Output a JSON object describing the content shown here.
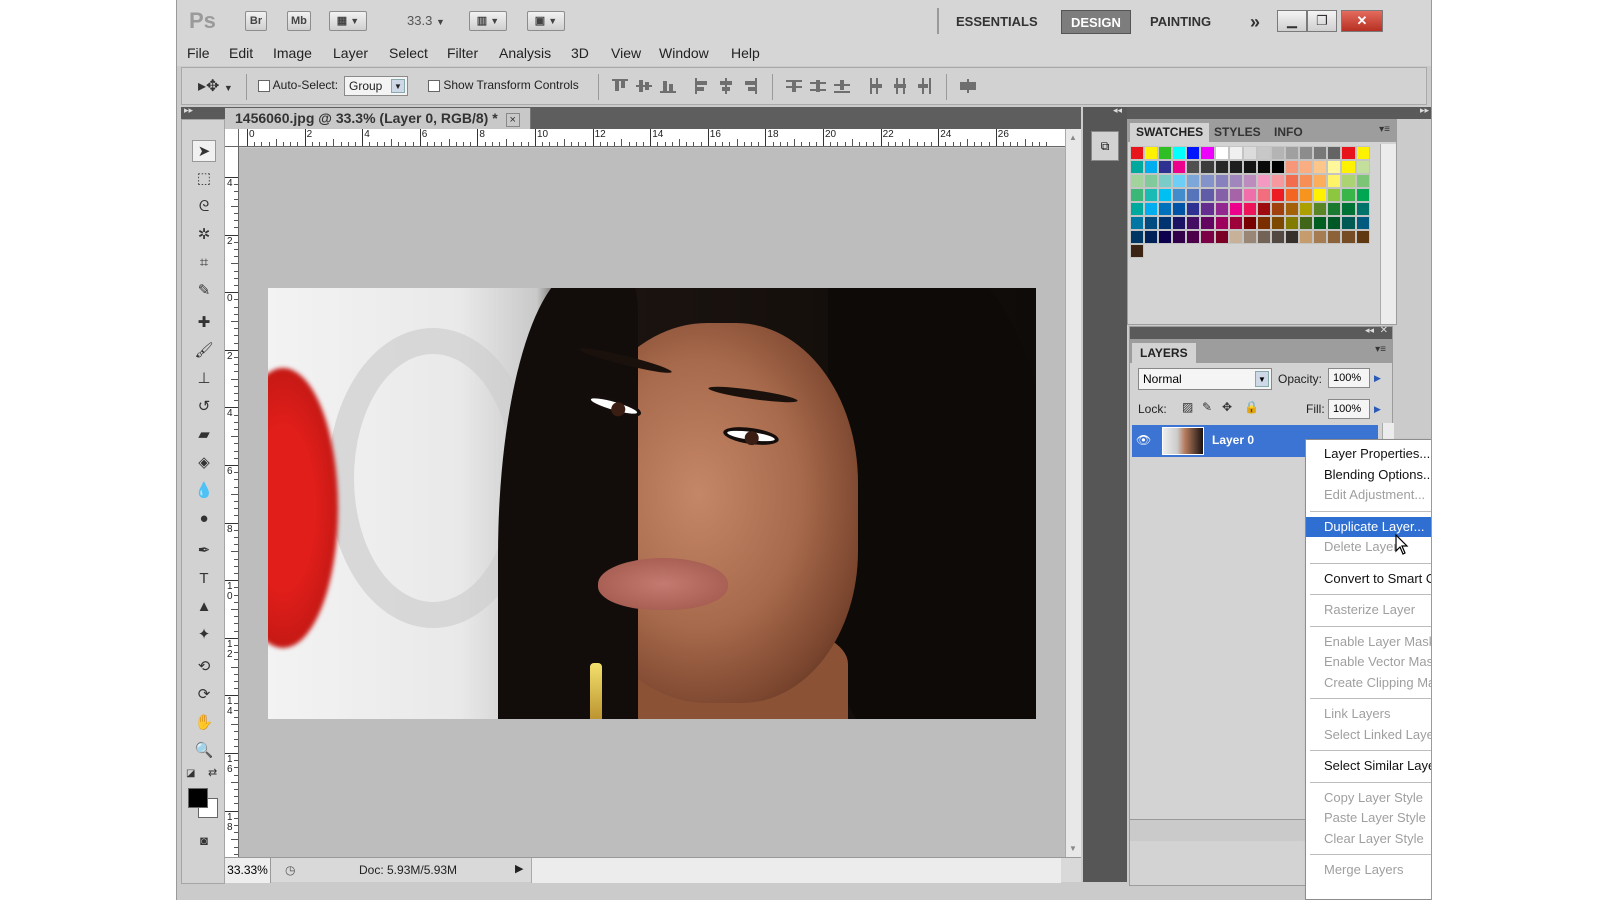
{
  "app": {
    "logo": "Ps",
    "bridge": "Br",
    "minibridge": "Mb",
    "zoom": "33.3",
    "workspaces": [
      "ESSENTIALS",
      "DESIGN",
      "PAINTING"
    ],
    "active_workspace": "DESIGN",
    "more": "»"
  },
  "menu": [
    "File",
    "Edit",
    "Image",
    "Layer",
    "Select",
    "Filter",
    "Analysis",
    "3D",
    "View",
    "Window",
    "Help"
  ],
  "options": {
    "auto_select_label": "Auto-Select:",
    "auto_select_value": "Group",
    "transform_label": "Show Transform Controls"
  },
  "document": {
    "tab_title": "1456060.jpg @ 33.3% (Layer 0, RGB/8) *",
    "close": "×",
    "ruler_h": [
      "0",
      "2",
      "4",
      "6",
      "8",
      "10",
      "12",
      "14",
      "16",
      "18",
      "20",
      "22",
      "24",
      "26"
    ],
    "ruler_v": [
      "4",
      "2",
      "0",
      "2",
      "4",
      "6",
      "8",
      "1 0",
      "1 2",
      "1 4",
      "1 6",
      "1 8"
    ],
    "zoom_status": "33.33%",
    "doc_status": "Doc: 5.93M/5.93M"
  },
  "swatches": {
    "tabs": [
      "SWATCHES",
      "STYLES",
      "INFO"
    ],
    "colors": [
      "#e8141c",
      "#fef200",
      "#2fbf25",
      "#00ffff",
      "#0015ff",
      "#ee00ff",
      "#ffffff",
      "#f0f0f0",
      "#dcdcdc",
      "#c8c8c8",
      "#b4b4b4",
      "#a0a0a0",
      "#8c8c8c",
      "#787878",
      "#646464",
      "#e8141c",
      "#fef200",
      "#00a99d",
      "#00aeef",
      "#2e3192",
      "#ec008c",
      "#505050",
      "#3c3c3c",
      "#282828",
      "#1e1e1e",
      "#141414",
      "#0a0a0a",
      "#000000",
      "#f7977a",
      "#f9ad81",
      "#fdc68a",
      "#fff79a",
      "#fff200",
      "#c4df9b",
      "#a3d39c",
      "#82ca9c",
      "#7accc8",
      "#6dcff6",
      "#7da7d9",
      "#8393ca",
      "#8781bd",
      "#a186be",
      "#bd8cbf",
      "#f49ac2",
      "#f6989d",
      "#f26c4f",
      "#f68e55",
      "#fbaf5d",
      "#fff467",
      "#acd372",
      "#7cc576",
      "#3bb878",
      "#1abbb4",
      "#00bff3",
      "#438ccb",
      "#5574b9",
      "#605ca8",
      "#855fa8",
      "#a763a8",
      "#f06ea9",
      "#f26d7d",
      "#ed1c24",
      "#f26522",
      "#f7941d",
      "#fff200",
      "#8dc63f",
      "#39b54a",
      "#00a651",
      "#00a99d",
      "#00aeef",
      "#0072bc",
      "#0054a6",
      "#2e3192",
      "#662d91",
      "#92278f",
      "#ec008c",
      "#ed145b",
      "#9e0b0f",
      "#a0410d",
      "#a36209",
      "#aba000",
      "#598527",
      "#1a7b30",
      "#007236",
      "#00746b",
      "#0076a3",
      "#004b80",
      "#003471",
      "#1b1464",
      "#440e62",
      "#630460",
      "#9e005d",
      "#9e0039",
      "#790000",
      "#7b2e00",
      "#7d4900",
      "#827b00",
      "#406618",
      "#005e20",
      "#005826",
      "#005952",
      "#005b7f",
      "#003663",
      "#002157",
      "#0d004c",
      "#32004b",
      "#4b0049",
      "#7b0046",
      "#7a0026",
      "#c7b299",
      "#998675",
      "#736357",
      "#534741",
      "#37302a",
      "#c69c6d",
      "#a67c52",
      "#8c6239",
      "#754c24",
      "#603913",
      "#3c2415"
    ]
  },
  "layers": {
    "title": "LAYERS",
    "blend_mode": "Normal",
    "opacity_label": "Opacity:",
    "opacity": "100%",
    "lock_label": "Lock:",
    "fill_label": "Fill:",
    "fill": "100%",
    "layer_name": "Layer 0"
  },
  "context_menu": [
    {
      "label": "Layer Properties...",
      "disabled": false
    },
    {
      "label": "Blending Options...",
      "disabled": false
    },
    {
      "label": "Edit Adjustment...",
      "disabled": true
    },
    {
      "sep": true
    },
    {
      "label": "Duplicate Layer...",
      "disabled": false,
      "hover": true
    },
    {
      "label": "Delete Layer",
      "disabled": true
    },
    {
      "sep": true
    },
    {
      "label": "Convert to Smart Object",
      "disabled": false
    },
    {
      "sep": true
    },
    {
      "label": "Rasterize Layer",
      "disabled": true
    },
    {
      "sep": true
    },
    {
      "label": "Enable Layer Mask",
      "disabled": true
    },
    {
      "label": "Enable Vector Mask",
      "disabled": true
    },
    {
      "label": "Create Clipping Mask",
      "disabled": true
    },
    {
      "sep": true
    },
    {
      "label": "Link Layers",
      "disabled": true
    },
    {
      "label": "Select Linked Layers",
      "disabled": true
    },
    {
      "sep": true
    },
    {
      "label": "Select Similar Layers",
      "disabled": false
    },
    {
      "sep": true
    },
    {
      "label": "Copy Layer Style",
      "disabled": true
    },
    {
      "label": "Paste Layer Style",
      "disabled": true
    },
    {
      "label": "Clear Layer Style",
      "disabled": true
    },
    {
      "sep": true
    },
    {
      "label": "Merge Layers",
      "disabled": true
    }
  ]
}
